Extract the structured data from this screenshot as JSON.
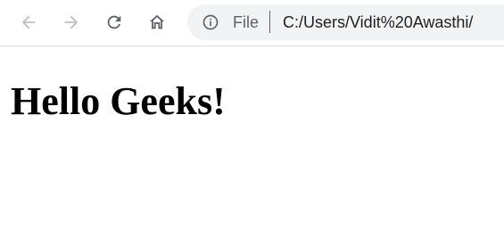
{
  "browser": {
    "nav": {
      "back_icon": "arrow-left-icon",
      "forward_icon": "arrow-right-icon",
      "reload_icon": "reload-icon",
      "home_icon": "home-icon"
    },
    "address_bar": {
      "info_icon": "info-icon",
      "scheme_label": "File",
      "url": "C:/Users/Vidit%20Awasthi/"
    },
    "colors": {
      "disabled_icon": "#bdc1c6",
      "icon": "#5f6368",
      "omnibox_bg": "#f1f3f4",
      "url_text": "#202124"
    }
  },
  "page": {
    "heading": "Hello Geeks!"
  }
}
